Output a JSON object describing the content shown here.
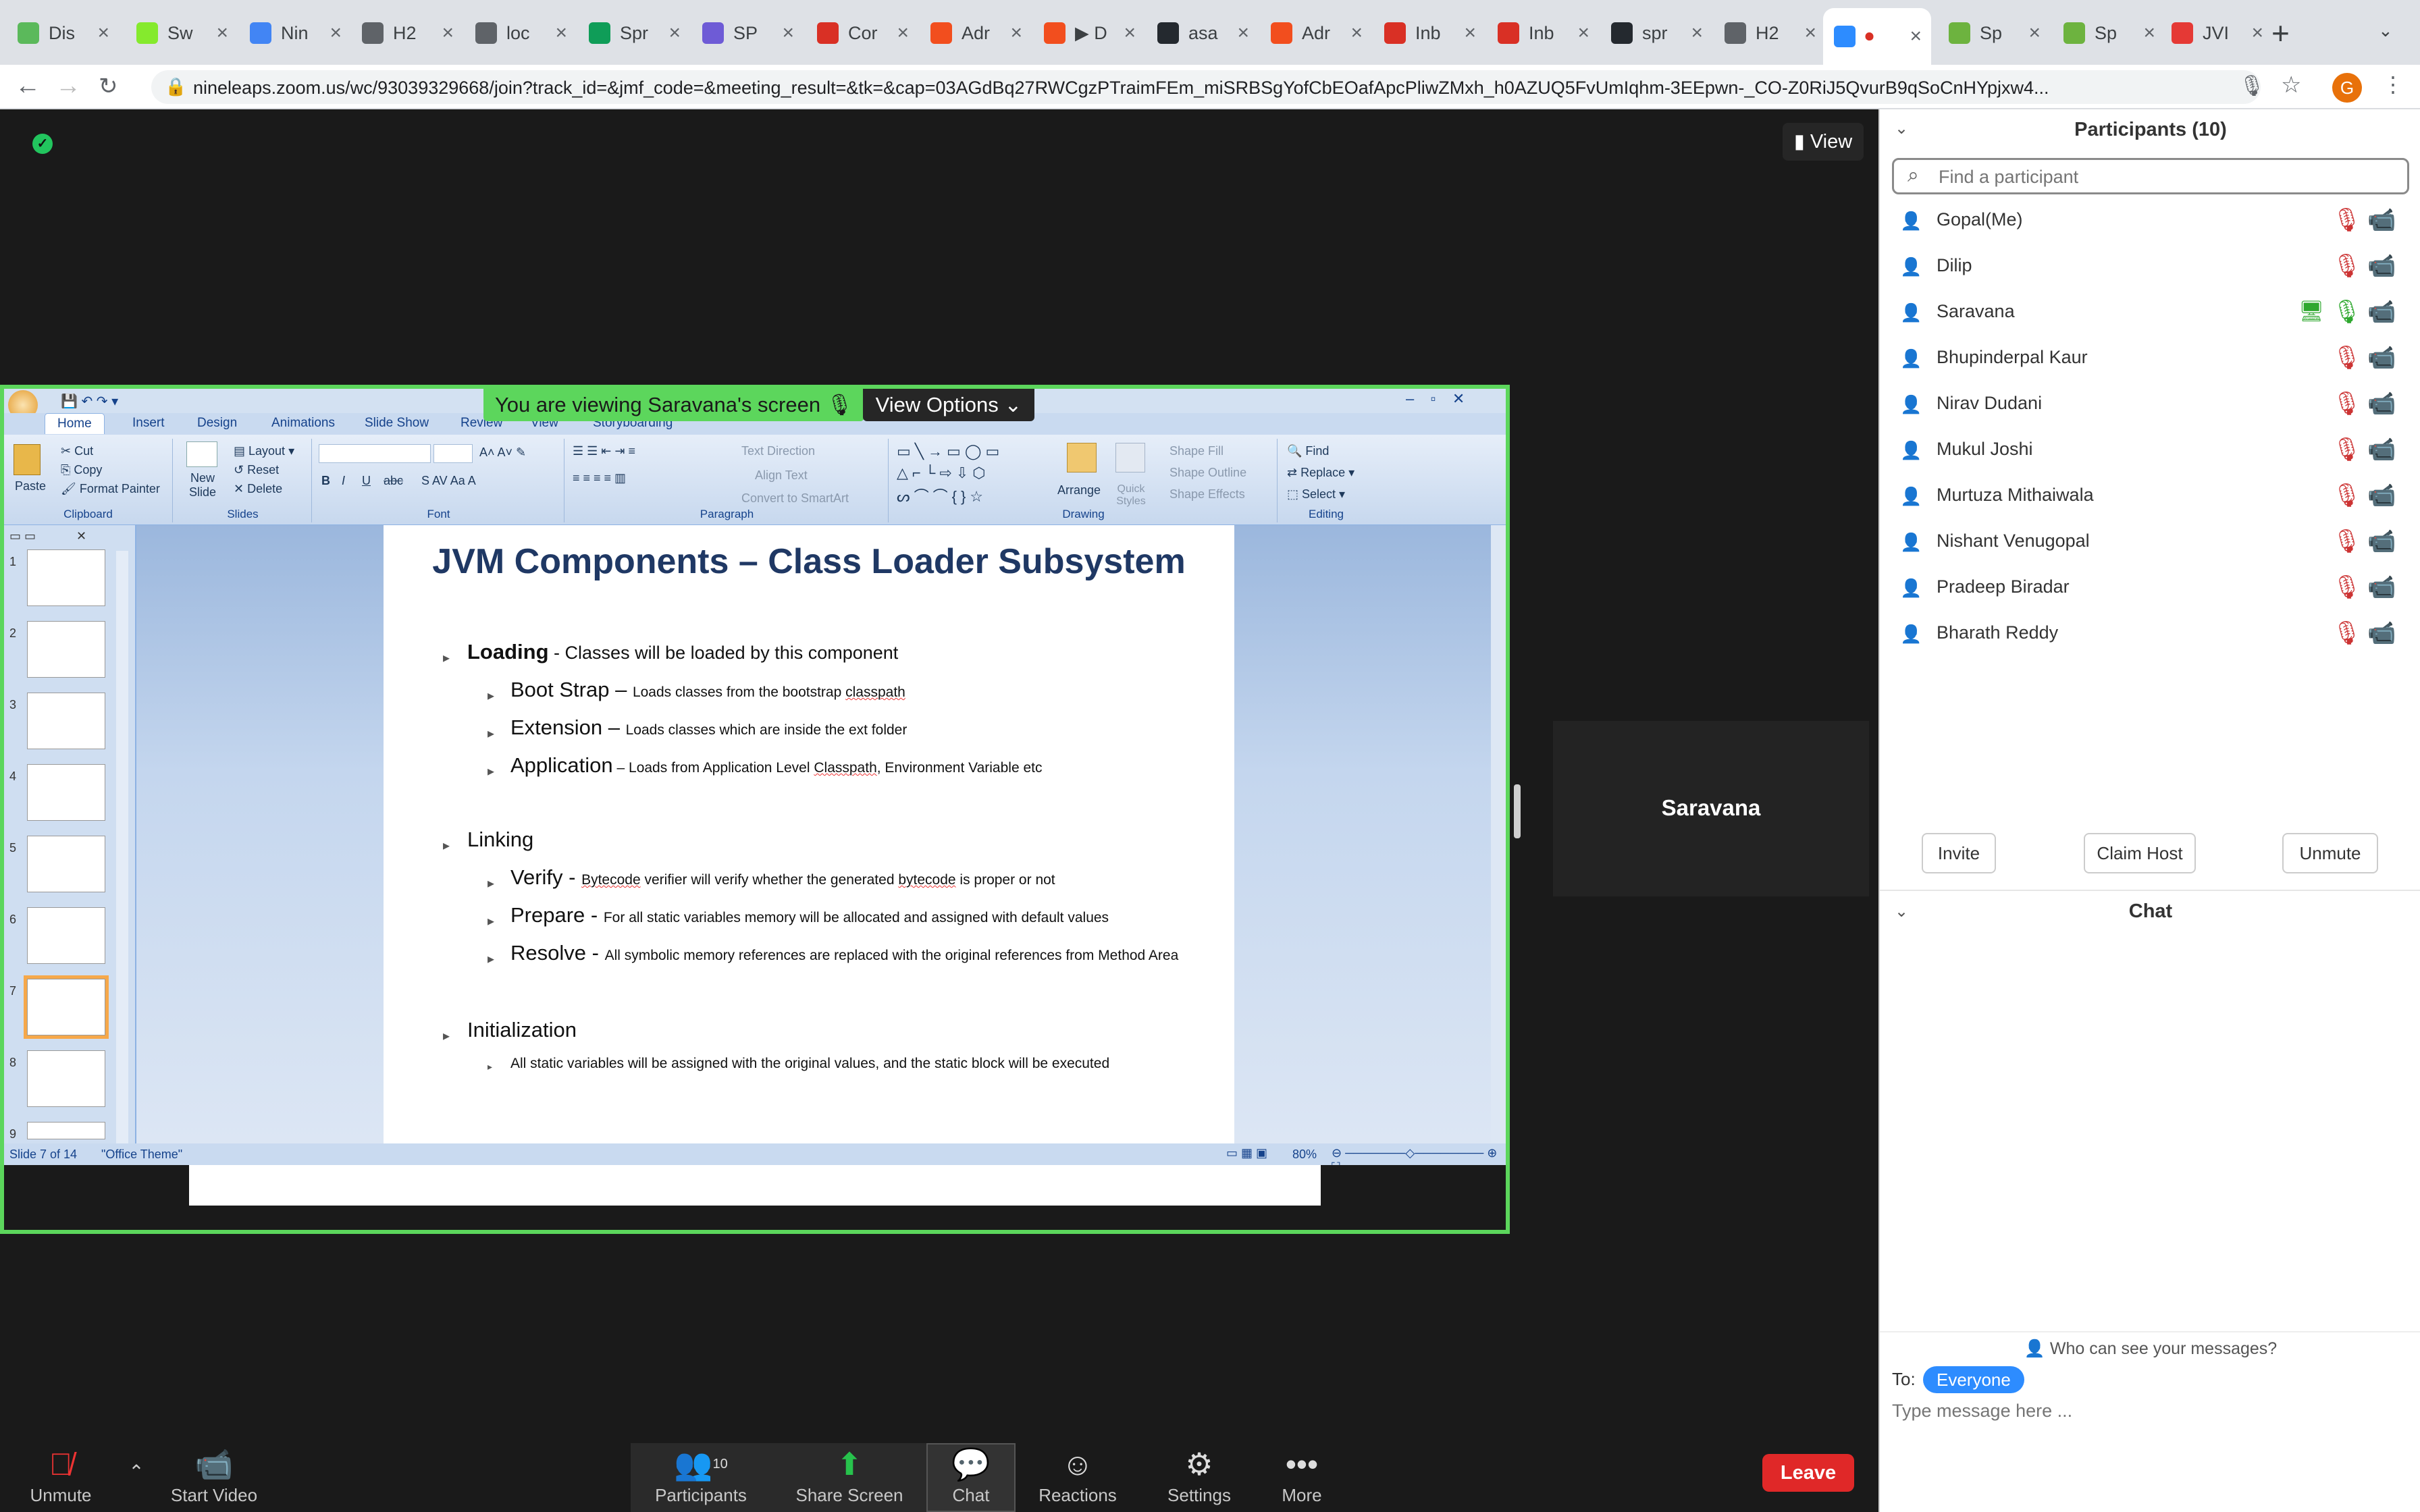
{
  "browser": {
    "tabs": [
      {
        "label": "Dis",
        "color": "#5bb95b"
      },
      {
        "label": "Sw",
        "color": "#85ea2d"
      },
      {
        "label": "Nin",
        "color": "#4285f4"
      },
      {
        "label": "H2",
        "color": "#5f6368"
      },
      {
        "label": "loc",
        "color": "#5f6368"
      },
      {
        "label": "Spr",
        "color": "#0f9d58"
      },
      {
        "label": "SP",
        "color": "#6e5bd6"
      },
      {
        "label": "Cor",
        "color": "#d93025"
      },
      {
        "label": "Adr",
        "color": "#f24e1e"
      },
      {
        "label": "▶ D",
        "color": "#f24e1e"
      },
      {
        "label": "asa",
        "color": "#24292f"
      },
      {
        "label": "Adr",
        "color": "#f24e1e"
      },
      {
        "label": "Inb",
        "color": "#d93025"
      },
      {
        "label": "Inb",
        "color": "#d93025"
      },
      {
        "label": "spr",
        "color": "#24292f"
      },
      {
        "label": "H2",
        "color": "#5f6368"
      },
      {
        "label": "",
        "color": "#2d8cff"
      },
      {
        "label": "Sp",
        "color": "#6db33f"
      },
      {
        "label": "Sp",
        "color": "#6db33f"
      },
      {
        "label": "JVI",
        "color": "#e53935"
      }
    ],
    "url": "nineleaps.zoom.us/wc/93039329668/join?track_id=&jmf_code=&meeting_result=&tk=&cap=03AGdBq27RWCgzPTraimFEm_miSRBSgYofCbEOafApcPliwZMxh_h0AZUQ5FvUmIqhm-3EEpwn-_CO-Z0RiJ5QvurB9qSoCnHYpjxw4...",
    "profile_initial": "G"
  },
  "zoom": {
    "view_label": "View",
    "banner": "You are viewing Saravana's screen",
    "view_options": "View Options",
    "speaker_name": "Saravana"
  },
  "ppt": {
    "tabs": [
      "Home",
      "Insert",
      "Design",
      "Animations",
      "Slide Show",
      "Review",
      "View",
      "Storyboarding"
    ],
    "groups": {
      "clipboard": "Clipboard",
      "slides": "Slides",
      "font": "Font",
      "paragraph": "Paragraph",
      "drawing": "Drawing",
      "editing": "Editing"
    },
    "clipboard_items": [
      "Cut",
      "Copy",
      "Format Painter"
    ],
    "paste": "Paste",
    "new_slide": "New Slide",
    "slides_items": [
      "Layout",
      "Reset",
      "Delete"
    ],
    "paragraph_items": [
      "Text Direction",
      "Align Text",
      "Convert to SmartArt"
    ],
    "drawing_items": [
      "Arrange",
      "Quick Styles",
      "Shape Fill",
      "Shape Outline",
      "Shape Effects"
    ],
    "editing_items": [
      "Find",
      "Replace",
      "Select"
    ],
    "thumb_numbers": [
      "1",
      "2",
      "3",
      "4",
      "5",
      "6",
      "7",
      "8",
      "9"
    ],
    "status_slide": "Slide 7 of 14",
    "status_theme": "\"Office Theme\"",
    "zoom_level": "80%",
    "slide": {
      "title": "JVM Components – Class Loader Subsystem",
      "loading_head": "Loading",
      "loading_desc": " - Classes will be loaded by this component",
      "bootstrap_head": "Boot Strap",
      "bootstrap_dash": " – ",
      "bootstrap_desc": "Loads classes from the bootstrap ",
      "bootstrap_word": "classpath",
      "extension_head": "Extension",
      "extension_dash": " – ",
      "extension_desc": "Loads classes which are inside the ext folder",
      "application_head": "Application",
      "application_dash": " – ",
      "application_desc1": "Loads from Application Level ",
      "application_word": "Classpath",
      "application_desc2": ", Environment Variable etc",
      "linking_head": "Linking",
      "verify_head": "Verify",
      "verify_dash": " - ",
      "verify_word1": "Bytecode",
      "verify_desc1": " verifier will verify whether the generated ",
      "verify_word2": "bytecode",
      "verify_desc2": " is proper or not",
      "prepare_head": "Prepare",
      "prepare_dash": " - ",
      "prepare_desc": "For all static variables memory will be allocated and assigned with default values",
      "resolve_head": "Resolve",
      "resolve_dash": " - ",
      "resolve_desc": "All symbolic memory references are replaced with the original  references from Method Area",
      "init_head": "Initialization",
      "init_desc": "All static variables will be assigned with the original values, and the static block will be executed"
    }
  },
  "toolbar": {
    "unmute": "Unmute",
    "start_video": "Start Video",
    "participants": "Participants",
    "participants_count": "10",
    "share_screen": "Share Screen",
    "chat": "Chat",
    "reactions": "Reactions",
    "settings": "Settings",
    "more": "More",
    "leave": "Leave"
  },
  "panel": {
    "title": "Participants (10)",
    "search_placeholder": "Find a participant",
    "participants": [
      {
        "name": "Gopal(Me)"
      },
      {
        "name": "Dilip"
      },
      {
        "name": "Saravana"
      },
      {
        "name": "Bhupinderpal Kaur"
      },
      {
        "name": "Nirav Dudani"
      },
      {
        "name": "Mukul Joshi"
      },
      {
        "name": "Murtuza Mithaiwala"
      },
      {
        "name": "Nishant Venugopal"
      },
      {
        "name": "Pradeep Biradar"
      },
      {
        "name": "Bharath Reddy"
      }
    ],
    "invite": "Invite",
    "claim_host": "Claim Host",
    "unmute": "Unmute",
    "chat_title": "Chat",
    "who_can_see": "Who can see your messages?",
    "to_label": "To:",
    "to_value": "Everyone",
    "message_placeholder": "Type message here ..."
  }
}
